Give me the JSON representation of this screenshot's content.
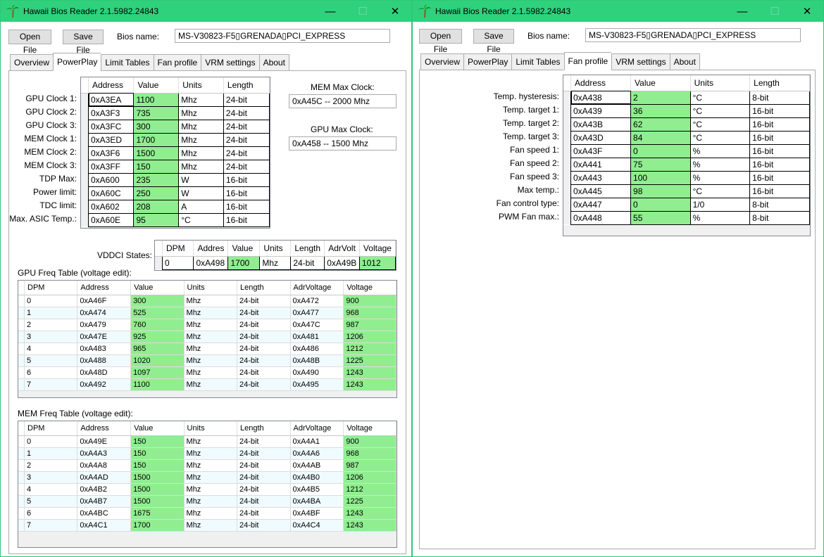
{
  "app": {
    "title": "Hawaii Bios Reader 2.1.5982.24843",
    "minimize_glyph": "—",
    "maximize_glyph": "☐",
    "close_glyph": "✕",
    "accent_color": "#2fd17c",
    "value_cell_color": "#90ee90"
  },
  "toolbar": {
    "open_label": "Open File",
    "save_label": "Save File",
    "bios_name_label": "Bios name:",
    "bios_name_value": "MS-V30823-F5▯GRENADA▯PCI_EXPRESS"
  },
  "tabs": [
    "Overview",
    "PowerPlay",
    "Limit Tables",
    "Fan profile",
    "VRM settings",
    "About"
  ],
  "left_window": {
    "active_tab": "PowerPlay",
    "pp_headers": [
      "Address",
      "Value",
      "Units",
      "Length"
    ],
    "pp_rows": [
      {
        "label": "GPU Clock 1:",
        "address": "0xA3EA",
        "value": "1100",
        "units": "Mhz",
        "length": "24-bit"
      },
      {
        "label": "GPU Clock 2:",
        "address": "0xA3F3",
        "value": "735",
        "units": "Mhz",
        "length": "24-bit"
      },
      {
        "label": "GPU Clock 3:",
        "address": "0xA3FC",
        "value": "300",
        "units": "Mhz",
        "length": "24-bit"
      },
      {
        "label": "MEM Clock 1:",
        "address": "0xA3ED",
        "value": "1700",
        "units": "Mhz",
        "length": "24-bit"
      },
      {
        "label": "MEM Clock 2:",
        "address": "0xA3F6",
        "value": "1500",
        "units": "Mhz",
        "length": "24-bit"
      },
      {
        "label": "MEM Clock 3:",
        "address": "0xA3FF",
        "value": "150",
        "units": "Mhz",
        "length": "24-bit"
      },
      {
        "label": "TDP Max:",
        "address": "0xA600",
        "value": "235",
        "units": "W",
        "length": "16-bit"
      },
      {
        "label": "Power limit:",
        "address": "0xA60C",
        "value": "250",
        "units": "W",
        "length": "16-bit"
      },
      {
        "label": "TDC limit:",
        "address": "0xA602",
        "value": "208",
        "units": "A",
        "length": "16-bit"
      },
      {
        "label": "Max. ASIC Temp.:",
        "address": "0xA60E",
        "value": "95",
        "units": "°C",
        "length": "16-bit"
      }
    ],
    "mem_max_clock_label": "MEM Max Clock:",
    "mem_max_clock_value": "0xA45C -- 2000 Mhz",
    "gpu_max_clock_label": "GPU Max Clock:",
    "gpu_max_clock_value": "0xA458 -- 1500 Mhz",
    "vddci_label": "VDDCI States:",
    "vddci_headers": [
      "DPM",
      "Addres",
      "Value",
      "Units",
      "Length",
      "AdrVolt",
      "Voltage"
    ],
    "vddci_row": [
      "0",
      "0xA498",
      "1700",
      "Mhz",
      "24-bit",
      "0xA49B",
      "1012"
    ],
    "gpu_freq_title": "GPU Freq Table (voltage edit):",
    "freq_headers": [
      "DPM",
      "Address",
      "Value",
      "Units",
      "Length",
      "AdrVoltage",
      "Voltage"
    ],
    "gpu_freq_rows": [
      [
        "0",
        "0xA46F",
        "300",
        "Mhz",
        "24-bit",
        "0xA472",
        "900"
      ],
      [
        "1",
        "0xA474",
        "525",
        "Mhz",
        "24-bit",
        "0xA477",
        "968"
      ],
      [
        "2",
        "0xA479",
        "760",
        "Mhz",
        "24-bit",
        "0xA47C",
        "987"
      ],
      [
        "3",
        "0xA47E",
        "925",
        "Mhz",
        "24-bit",
        "0xA481",
        "1206"
      ],
      [
        "4",
        "0xA483",
        "965",
        "Mhz",
        "24-bit",
        "0xA486",
        "1212"
      ],
      [
        "5",
        "0xA488",
        "1020",
        "Mhz",
        "24-bit",
        "0xA48B",
        "1225"
      ],
      [
        "6",
        "0xA48D",
        "1097",
        "Mhz",
        "24-bit",
        "0xA490",
        "1243"
      ],
      [
        "7",
        "0xA492",
        "1100",
        "Mhz",
        "24-bit",
        "0xA495",
        "1243"
      ]
    ],
    "mem_freq_title": "MEM Freq Table (voltage edit):",
    "mem_freq_rows": [
      [
        "0",
        "0xA49E",
        "150",
        "Mhz",
        "24-bit",
        "0xA4A1",
        "900"
      ],
      [
        "1",
        "0xA4A3",
        "150",
        "Mhz",
        "24-bit",
        "0xA4A6",
        "968"
      ],
      [
        "2",
        "0xA4A8",
        "150",
        "Mhz",
        "24-bit",
        "0xA4AB",
        "987"
      ],
      [
        "3",
        "0xA4AD",
        "1500",
        "Mhz",
        "24-bit",
        "0xA4B0",
        "1206"
      ],
      [
        "4",
        "0xA4B2",
        "1500",
        "Mhz",
        "24-bit",
        "0xA4B5",
        "1212"
      ],
      [
        "5",
        "0xA4B7",
        "1500",
        "Mhz",
        "24-bit",
        "0xA4BA",
        "1225"
      ],
      [
        "6",
        "0xA4BC",
        "1675",
        "Mhz",
        "24-bit",
        "0xA4BF",
        "1243"
      ],
      [
        "7",
        "0xA4C1",
        "1700",
        "Mhz",
        "24-bit",
        "0xA4C4",
        "1243"
      ]
    ]
  },
  "right_window": {
    "active_tab": "Fan profile",
    "fan_headers": [
      "Address",
      "Value",
      "Units",
      "Length"
    ],
    "fan_rows": [
      {
        "label": "Temp. hysteresis:",
        "address": "0xA438",
        "value": "2",
        "units": "°C",
        "length": "8-bit"
      },
      {
        "label": "Temp. target 1:",
        "address": "0xA439",
        "value": "36",
        "units": "°C",
        "length": "16-bit"
      },
      {
        "label": "Temp. target 2:",
        "address": "0xA43B",
        "value": "62",
        "units": "°C",
        "length": "16-bit"
      },
      {
        "label": "Temp. target 3:",
        "address": "0xA43D",
        "value": "84",
        "units": "°C",
        "length": "16-bit"
      },
      {
        "label": "Fan speed 1:",
        "address": "0xA43F",
        "value": "0",
        "units": "%",
        "length": "16-bit"
      },
      {
        "label": "Fan speed 2:",
        "address": "0xA441",
        "value": "75",
        "units": "%",
        "length": "16-bit"
      },
      {
        "label": "Fan speed 3:",
        "address": "0xA443",
        "value": "100",
        "units": "%",
        "length": "16-bit"
      },
      {
        "label": "Max temp.:",
        "address": "0xA445",
        "value": "98",
        "units": "°C",
        "length": "16-bit"
      },
      {
        "label": "Fan control type:",
        "address": "0xA447",
        "value": "0",
        "units": "1/0",
        "length": "8-bit"
      },
      {
        "label": "PWM Fan max.:",
        "address": "0xA448",
        "value": "55",
        "units": "%",
        "length": "8-bit"
      }
    ]
  }
}
